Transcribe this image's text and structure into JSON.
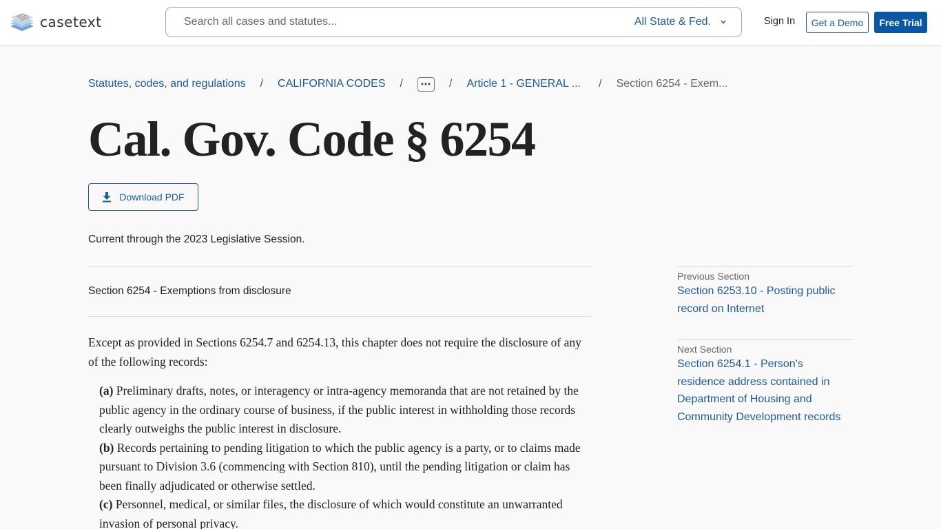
{
  "header": {
    "logo_text": "casetext",
    "search_placeholder": "Search all cases and statutes...",
    "search_value": "",
    "jurisdiction_selected": "All State & Fed.",
    "sign_in_label": "Sign In",
    "demo_label": "Get a Demo",
    "trial_label": "Free Trial"
  },
  "breadcrumb": [
    {
      "label": "Statutes, codes, and regulations"
    },
    {
      "label": "CALIFORNIA CODES"
    },
    {
      "label": "..."
    },
    {
      "label": "Article 1 - GENERAL ..."
    },
    {
      "label": "Section 6254 - Exem..."
    }
  ],
  "page": {
    "title": "Cal. Gov. Code § 6254",
    "download_label": "Download PDF",
    "currency_note": "Current through the 2023 Legislative Session.",
    "section_heading": "Section 6254 - Exemptions from disclosure",
    "intro": "Except as provided in Sections 6254.7 and 6254.13, this chapter does not require the disclosure of any of the following records:",
    "items": [
      {
        "label": "(a)",
        "text": " Preliminary drafts, notes, or interagency or intra-agency memoranda that are not retained by the public agency in the ordinary course of business, if the public interest in withholding those records clearly outweighs the public interest in disclosure."
      },
      {
        "label": "(b)",
        "text": " Records pertaining to pending litigation to which the public agency is a party, or to claims made pursuant to Division 3.6 (commencing with Section 810), until the pending litigation or claim has been finally adjudicated or otherwise settled."
      },
      {
        "label": "(c)",
        "text": " Personnel, medical, or similar files, the disclosure of which would constitute an unwarranted invasion of personal privacy."
      }
    ]
  },
  "sidebar": {
    "previous_label": "Previous Section",
    "previous_link": "Section 6253.10 - Posting public record on Internet",
    "next_label": "Next Section",
    "next_link": "Section 6254.1 - Person's residence address contained in Department of Housing and Community Development records"
  },
  "colors": {
    "brand_blue": "#0a57a5",
    "link_blue": "#1f5a96",
    "background": "#f9f9f9"
  }
}
